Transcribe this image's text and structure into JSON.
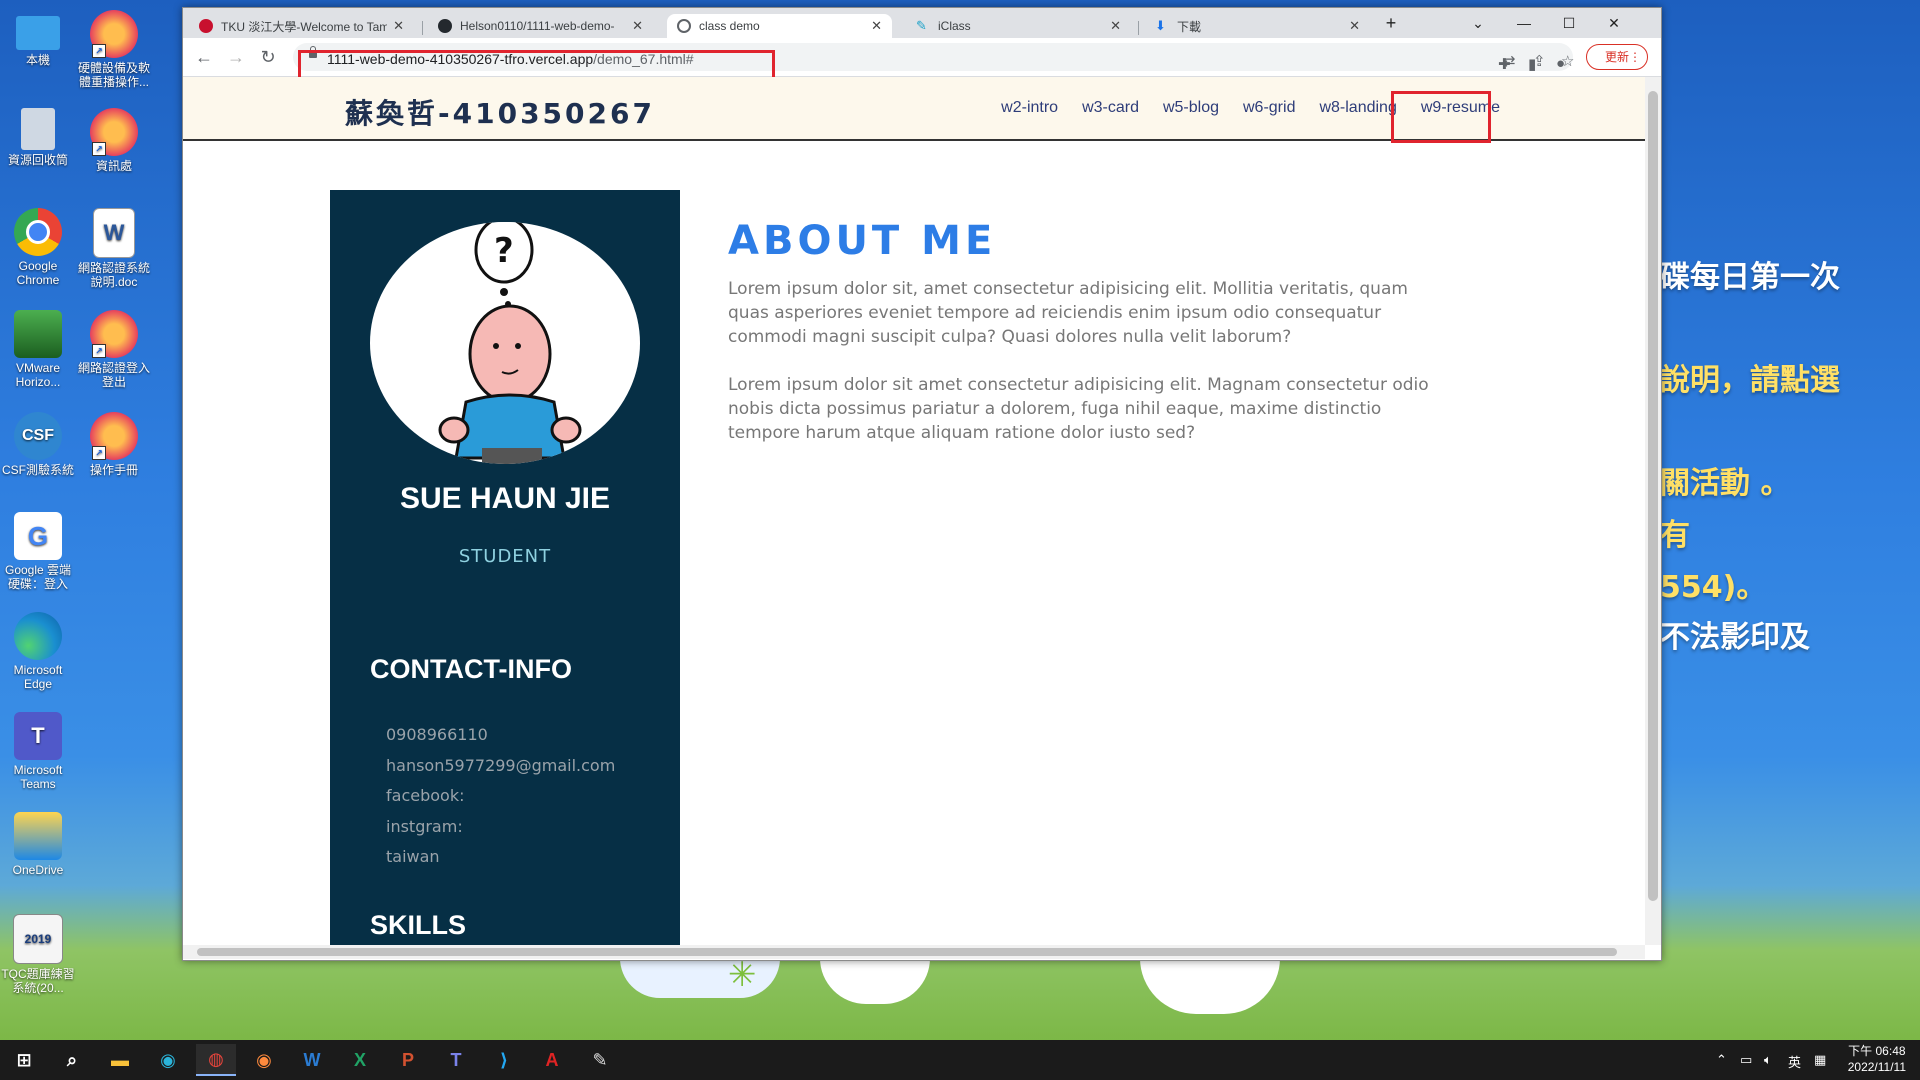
{
  "desktop": {
    "icons": [
      {
        "label": "本機"
      },
      {
        "label": "硬體設備及軟體重播操作..."
      },
      {
        "label": "資源回收筒"
      },
      {
        "label": "資訊處"
      },
      {
        "label": "Google Chrome"
      },
      {
        "label": "網路認證系統說明.doc"
      },
      {
        "label": "VMware Horizo..."
      },
      {
        "label": "網路認證登入登出"
      },
      {
        "label": "CSF測驗系統"
      },
      {
        "label": "操作手冊"
      },
      {
        "label": "Google 雲端硬碟：登入"
      },
      {
        "label": "Microsoft Edge"
      },
      {
        "label": "Microsoft Teams"
      },
      {
        "label": "OneDrive"
      },
      {
        "label": "TQC題庫練習系統(20..."
      }
    ],
    "background_text": [
      "碟每日第一次",
      "說明，請點選",
      "關活動 。",
      "有",
      "554)。",
      "不法影印及"
    ]
  },
  "browser": {
    "tabs": [
      {
        "title": "TKU 淡江大學-Welcome to Tam",
        "icon": "tku-icon"
      },
      {
        "title": "Helson0110/1111-web-demo-",
        "icon": "github-icon"
      },
      {
        "title": "class demo",
        "icon": "globe-icon",
        "active": true
      },
      {
        "title": "iClass",
        "icon": "iclass-icon"
      },
      {
        "title": "下載",
        "icon": "download-icon"
      }
    ],
    "new_tab_label": "+",
    "url_host": "1111-web-demo-410350267-tfro.vercel.app",
    "url_path": "/demo_67.html#",
    "update_label": "更新"
  },
  "site": {
    "brand": "蘇奐哲-410350267",
    "nav": [
      "w2-intro",
      "w3-card",
      "w5-blog",
      "w6-grid",
      "w8-landing",
      "w9-resume"
    ],
    "profile": {
      "name": "SUE HAUN JIE",
      "role": "STUDENT"
    },
    "contact_heading": "CONTACT-INFO",
    "contact": [
      "0908966110",
      "hanson5977299@gmail.com",
      "facebook:",
      "instgram:",
      "taiwan"
    ],
    "skills_heading": "SKILLS",
    "about": {
      "title": "ABOUT ME",
      "paragraphs": [
        "Lorem ipsum dolor sit, amet consectetur adipisicing elit. Mollitia veritatis, quam quas asperiores eveniet tempore ad reiciendis enim ipsum odio consequatur commodi magni suscipit culpa? Quasi dolores nulla velit laborum?",
        "Lorem ipsum dolor sit amet consectetur adipisicing elit. Magnam consectetur odio nobis dicta possimus pariatur a dolorem, fuga nihil eaque, maxime distinctio tempore harum atque aliquam ratione dolor iusto sed?"
      ]
    }
  },
  "taskbar": {
    "tray_lang": "英",
    "time": "下午 06:48",
    "date": "2022/11/11"
  },
  "colors": {
    "sidebar_bg": "#062f45",
    "accent_blue": "#2d7de6",
    "highlight_red": "#e0242e",
    "header_bg": "#fdf8ec"
  }
}
